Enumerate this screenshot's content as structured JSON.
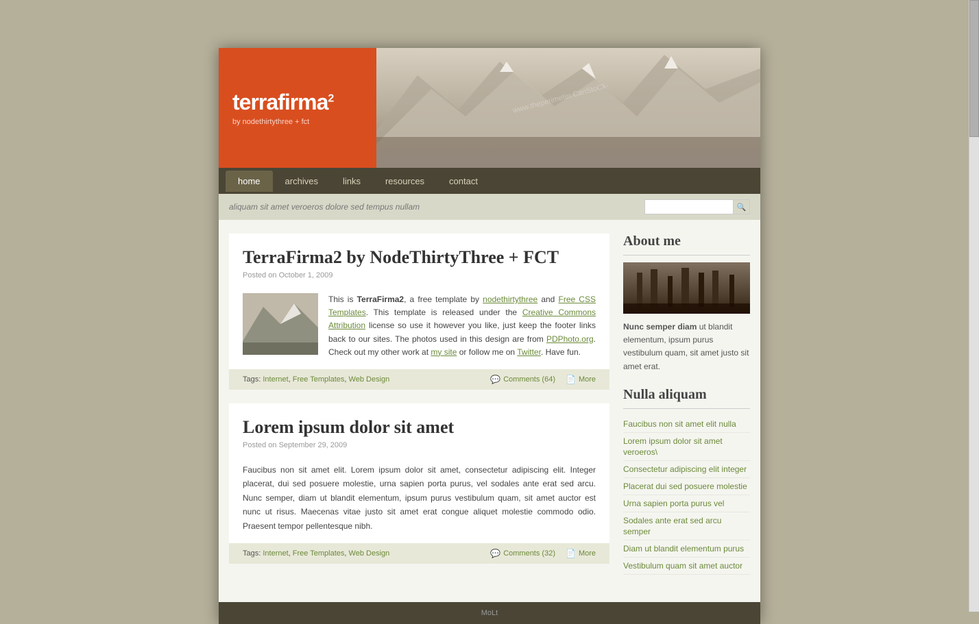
{
  "site": {
    "title": "terrafirma",
    "title_sup": "2",
    "subtitle": "by nodethirtythree + fct",
    "tagline": "aliquam sit amet veroeros dolore sed tempus nullam"
  },
  "nav": {
    "items": [
      {
        "label": "home",
        "active": true
      },
      {
        "label": "archives",
        "active": false
      },
      {
        "label": "links",
        "active": false
      },
      {
        "label": "resources",
        "active": false
      },
      {
        "label": "contact",
        "active": false
      }
    ]
  },
  "search": {
    "placeholder": "",
    "button_icon": "🔍"
  },
  "posts": [
    {
      "title": "TerraFirma2 by NodeThirtyThree + FCT",
      "date": "Posted on October 1, 2009",
      "has_image": true,
      "body_html_id": "post1-body",
      "tags": [
        "Internet",
        "Free Templates",
        "Web Design"
      ],
      "comments_label": "Comments (64)",
      "more_label": "More"
    },
    {
      "title": "Lorem ipsum dolor sit amet",
      "date": "Posted on September 29, 2009",
      "has_image": false,
      "body_html_id": "post2-body",
      "tags": [
        "Internet",
        "Free Templates",
        "Web Design"
      ],
      "comments_label": "Comments (32)",
      "more_label": "More"
    }
  ],
  "post1_body": "This is TerraFirma2, a free template by nodethirtythree and Free CSS Templates. This template is released under the Creative Commons Attribution license so use it however you like, just keep the footer links back to our sites. The photos used in this design are from PDPhoto.org. Check out my other work at my site or follow me on Twitter. Have fun.",
  "post2_body": "Faucibus non sit amet elit. Lorem ipsum dolor sit amet, consectetur adipiscing elit. Integer placerat, dui sed posuere molestie, urna sapien porta purus, vel sodales ante erat sed arcu. Nunc semper, diam ut blandit elementum, ipsum purus vestibulum quam, sit amet auctor est nunc ut risus. Maecenas vitae justo sit amet erat congue aliquet molestie commodo odio. Praesent tempor pellentesque nibh.",
  "sidebar": {
    "about_title": "About me",
    "about_bio": "Nunc semper diam ut blandit elementum, ipsum purus vestibulum quam, sit amet justo sit amet erat.",
    "nulla_title": "Nulla aliquam",
    "links": [
      "Faucibus non sit amet elit nulla",
      "Lorem ipsum dolor sit amet veroeros\\",
      "Consectetur adipiscing elit integer",
      "Placerat dui sed posuere molestie",
      "Urna sapien porta purus vel",
      "Sodales ante erat sed arcu semper",
      "Diam ut blandit elementum purus",
      "Vestibulum quam sit amet auctor"
    ]
  },
  "footer": {
    "text": "MoLt"
  }
}
